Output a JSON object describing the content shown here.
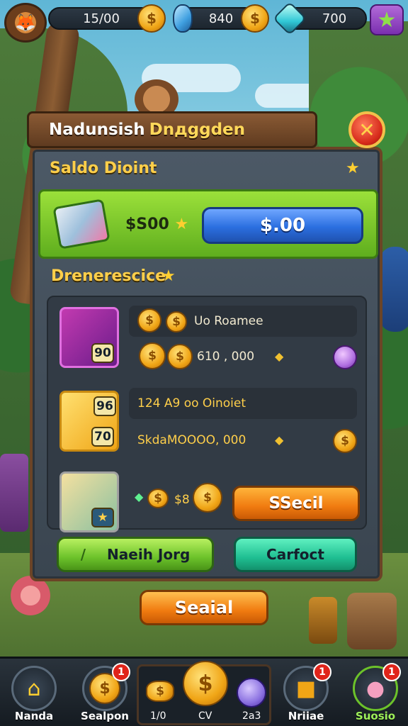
{
  "hud": {
    "coins_value": "15/00",
    "gems_blue_value": "840",
    "gems_cyan_value": "700"
  },
  "window": {
    "title_white": "Nadunsish",
    "title_gold": "Dnдggden",
    "close_glyph": "✕"
  },
  "offer": {
    "section_title": "Saldo Dioint",
    "price": "$S00",
    "buy_label": "$.00"
  },
  "list": {
    "section_title": "Drenerescice",
    "rows": [
      {
        "line1": "Uo Roamee",
        "line2": "610 , 000",
        "badge": "90"
      },
      {
        "line1": "124 A9 oo Oinoiet",
        "line2": "SkdaMOOOO, 000",
        "badge_top": "96",
        "badge": "70"
      },
      {
        "price_label": "$8",
        "select_label": "SSecil"
      }
    ]
  },
  "actions": {
    "left_label": "Naeih Jorg",
    "right_label": "Carfoct",
    "special_label": "Seaial"
  },
  "nav": {
    "items": [
      {
        "label": "Nanda"
      },
      {
        "label": "Sealpon",
        "badge": "1"
      },
      {
        "label": "Nriiae",
        "badge": "1"
      },
      {
        "label": "Suosio",
        "badge": "1"
      }
    ],
    "center_labels": [
      "1/0",
      "CV",
      "2a3"
    ]
  },
  "colors": {
    "accent_gold": "#ffcf4a",
    "buy_blue": "#2b6fe0",
    "select_orange": "#f07b10",
    "notif_red": "#e0241a"
  }
}
